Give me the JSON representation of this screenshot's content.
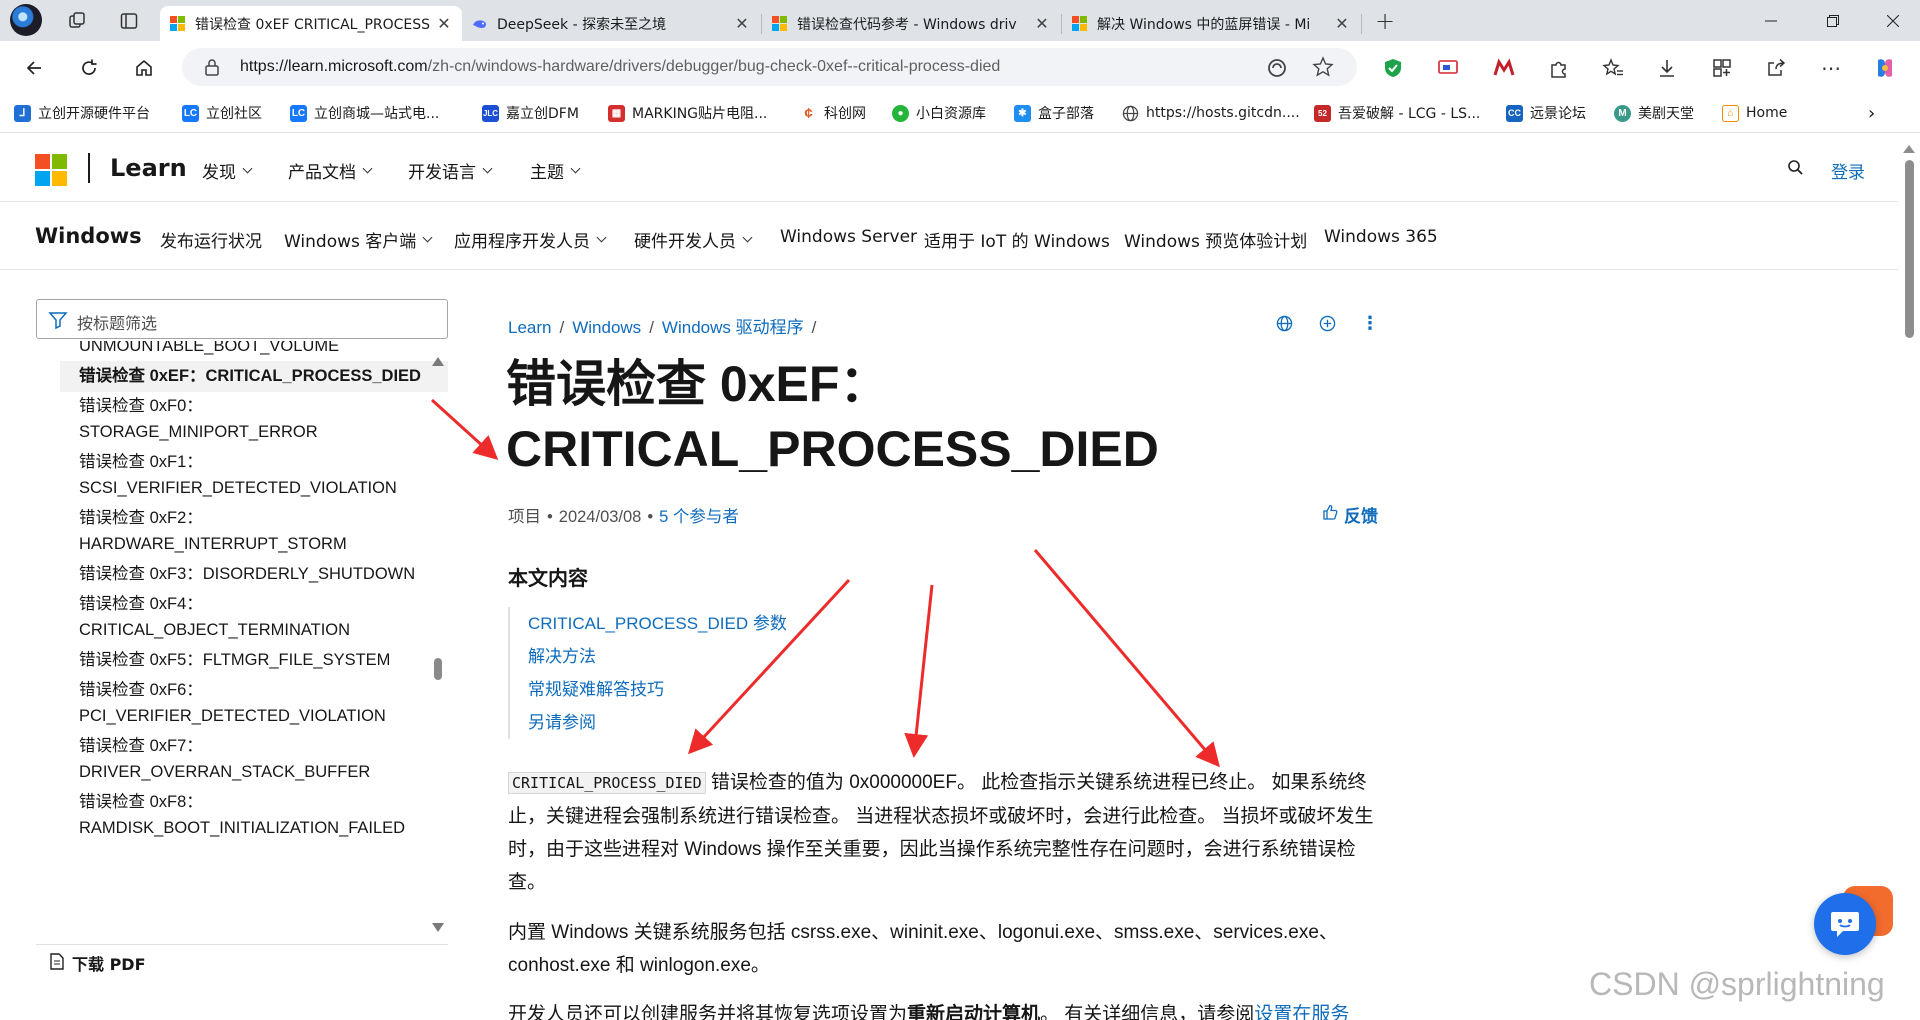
{
  "browser": {
    "tabs": [
      {
        "title": "错误检查 0xEF CRITICAL_PROCESS_DIED",
        "active": true
      },
      {
        "title": "DeepSeek - 探索未至之境",
        "active": false
      },
      {
        "title": "错误检查代码参考 - Windows driv",
        "active": false
      },
      {
        "title": "解决 Windows 中的蓝屏错误 - Mi",
        "active": false
      }
    ],
    "new_tab": "+",
    "url_host": "https://learn.microsoft.com",
    "url_path": "/zh-cn/windows-hardware/drivers/debugger/bug-check-0xef--critical-process-died",
    "bookmarks": [
      {
        "label": "立创开源硬件平台",
        "icon": "lceda",
        "color": "#1f6fd6"
      },
      {
        "label": "立创社区",
        "icon": "LC",
        "color": "#1677ff"
      },
      {
        "label": "立创商城—站式电...",
        "icon": "LC",
        "color": "#1677ff"
      },
      {
        "label": "嘉立创DFM",
        "icon": "JLC",
        "color": "#1b4fd6"
      },
      {
        "label": "MARKING贴片电阻...",
        "icon": "mk",
        "color": "#d32f2f"
      },
      {
        "label": "科创网",
        "icon": "kc",
        "color": "#e55a1e"
      },
      {
        "label": "小白资源库",
        "icon": "wx",
        "color": "#24b53a"
      },
      {
        "label": "盒子部落",
        "icon": "hz",
        "color": "#1e8ef2"
      },
      {
        "label": "https://hosts.gitcdn....",
        "icon": "globe",
        "color": "#555555"
      },
      {
        "label": "吾爱破解 - LCG - LS...",
        "icon": "52",
        "color": "#c62828"
      },
      {
        "label": "远景论坛",
        "icon": "CC",
        "color": "#1565c0"
      },
      {
        "label": "美剧天堂",
        "icon": "M",
        "color": "#3a9a8a"
      },
      {
        "label": "Home",
        "icon": "home",
        "color": "#f08c00"
      }
    ]
  },
  "header": {
    "brand": "Learn",
    "nav": [
      "发现",
      "产品文档",
      "开发语言",
      "主题"
    ],
    "signin": "登录"
  },
  "product": {
    "title": "Windows",
    "nav": [
      {
        "label": "发布运行状况",
        "dropdown": false
      },
      {
        "label": "Windows 客户端",
        "dropdown": true
      },
      {
        "label": "应用程序开发人员",
        "dropdown": true
      },
      {
        "label": "硬件开发人员",
        "dropdown": true
      },
      {
        "label": "Windows Server",
        "dropdown": false
      },
      {
        "label": "适用于 IoT 的 Windows",
        "dropdown": false
      },
      {
        "label": "Windows 预览体验计划",
        "dropdown": false
      },
      {
        "label": "Windows 365",
        "dropdown": false
      }
    ]
  },
  "toc": {
    "filter_placeholder": "按标题筛选",
    "items": [
      "UNMOUNTABLE_BOOT_VOLUME",
      "错误检查 0xEF：CRITICAL_PROCESS_DIED",
      "错误检查 0xF0：",
      "STORAGE_MINIPORT_ERROR",
      "错误检查 0xF1：",
      "SCSI_VERIFIER_DETECTED_VIOLATION",
      "错误检查 0xF2：",
      "HARDWARE_INTERRUPT_STORM",
      "错误检查 0xF3：DISORDERLY_SHUTDOWN",
      "错误检查 0xF4：",
      "CRITICAL_OBJECT_TERMINATION",
      "错误检查 0xF5：FLTMGR_FILE_SYSTEM",
      "错误检查 0xF6：",
      "PCI_VERIFIER_DETECTED_VIOLATION",
      "错误检查 0xF7：",
      "DRIVER_OVERRAN_STACK_BUFFER",
      "错误检查 0xF8：",
      "RAMDISK_BOOT_INITIALIZATION_FAILED"
    ],
    "download_pdf": "下载 PDF"
  },
  "article": {
    "breadcrumb": [
      "Learn",
      "Windows",
      "Windows 驱动程序"
    ],
    "title_line1": "错误检查 0xEF：",
    "title_line2": "CRITICAL_PROCESS_DIED",
    "meta_kind": "项目",
    "meta_date": "2024/03/08",
    "meta_contributors": "5 个参与者",
    "feedback": "反馈",
    "in_this_article": "本文内容",
    "sections": [
      "CRITICAL_PROCESS_DIED 参数",
      "解决方法",
      "常规疑难解答技巧",
      "另请参阅"
    ],
    "p1_code": "CRITICAL_PROCESS_DIED",
    "p1_text": " 错误检查的值为 0x000000EF。 此检查指示关键系统进程已终止。 如果系统终止，关键进程会强制系统进行错误检查。 当进程状态损坏或破坏时，会进行此检查。 当损坏或破坏发生时，由于这些进程对 Windows 操作至关重要，因此当操作系统完整性存在问题时，会进行系统错误检查。",
    "p2_text": "内置 Windows 关键系统服务包括 csrss.exe、wininit.exe、logonui.exe、smss.exe、services.exe、conhost.exe 和 winlogon.exe。",
    "p3_start": "开发人员还可以创建服务并将其恢复选项设置为",
    "p3_bold": "重新启动计算机",
    "p3_mid": "。 有关详细信息，请参阅",
    "p3_link": "设置在服务"
  },
  "watermark": "CSDN @sprlightning",
  "colors": {
    "accent": "#0f6cbd",
    "arrow": "#ee2b2b"
  }
}
